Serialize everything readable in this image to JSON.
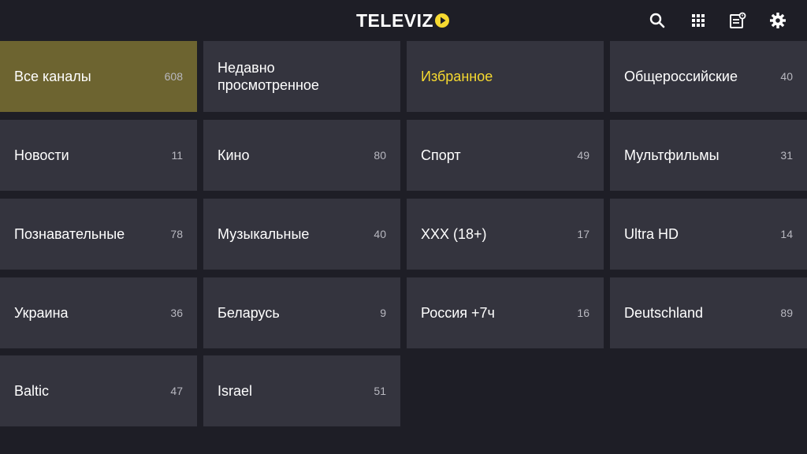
{
  "app": {
    "brand": "TELEVIZO",
    "brand_text": "TELEVIZ",
    "accent_color": "#f6d930",
    "active_tile_color": "#6d6430"
  },
  "toolbar": {
    "icons": [
      "search-icon",
      "grid-icon",
      "epg-icon",
      "gear-icon"
    ]
  },
  "categories": [
    {
      "label": "Все каналы",
      "count": "608"
    },
    {
      "label": "Недавно просмотренное",
      "count": ""
    },
    {
      "label": "Избранное",
      "count": ""
    },
    {
      "label": "Общероссийские",
      "count": "40"
    },
    {
      "label": "Новости",
      "count": "11"
    },
    {
      "label": "Кино",
      "count": "80"
    },
    {
      "label": "Спорт",
      "count": "49"
    },
    {
      "label": "Мультфильмы",
      "count": "31"
    },
    {
      "label": "Познавательные",
      "count": "78"
    },
    {
      "label": "Музыкальные",
      "count": "40"
    },
    {
      "label": "XXX (18+)",
      "count": "17"
    },
    {
      "label": "Ultra HD",
      "count": "14"
    },
    {
      "label": "Украина",
      "count": "36"
    },
    {
      "label": "Беларусь",
      "count": "9"
    },
    {
      "label": "Россия +7ч",
      "count": "16"
    },
    {
      "label": "Deutschland",
      "count": "89"
    },
    {
      "label": "Baltic",
      "count": "47"
    },
    {
      "label": "Israel",
      "count": "51"
    }
  ]
}
